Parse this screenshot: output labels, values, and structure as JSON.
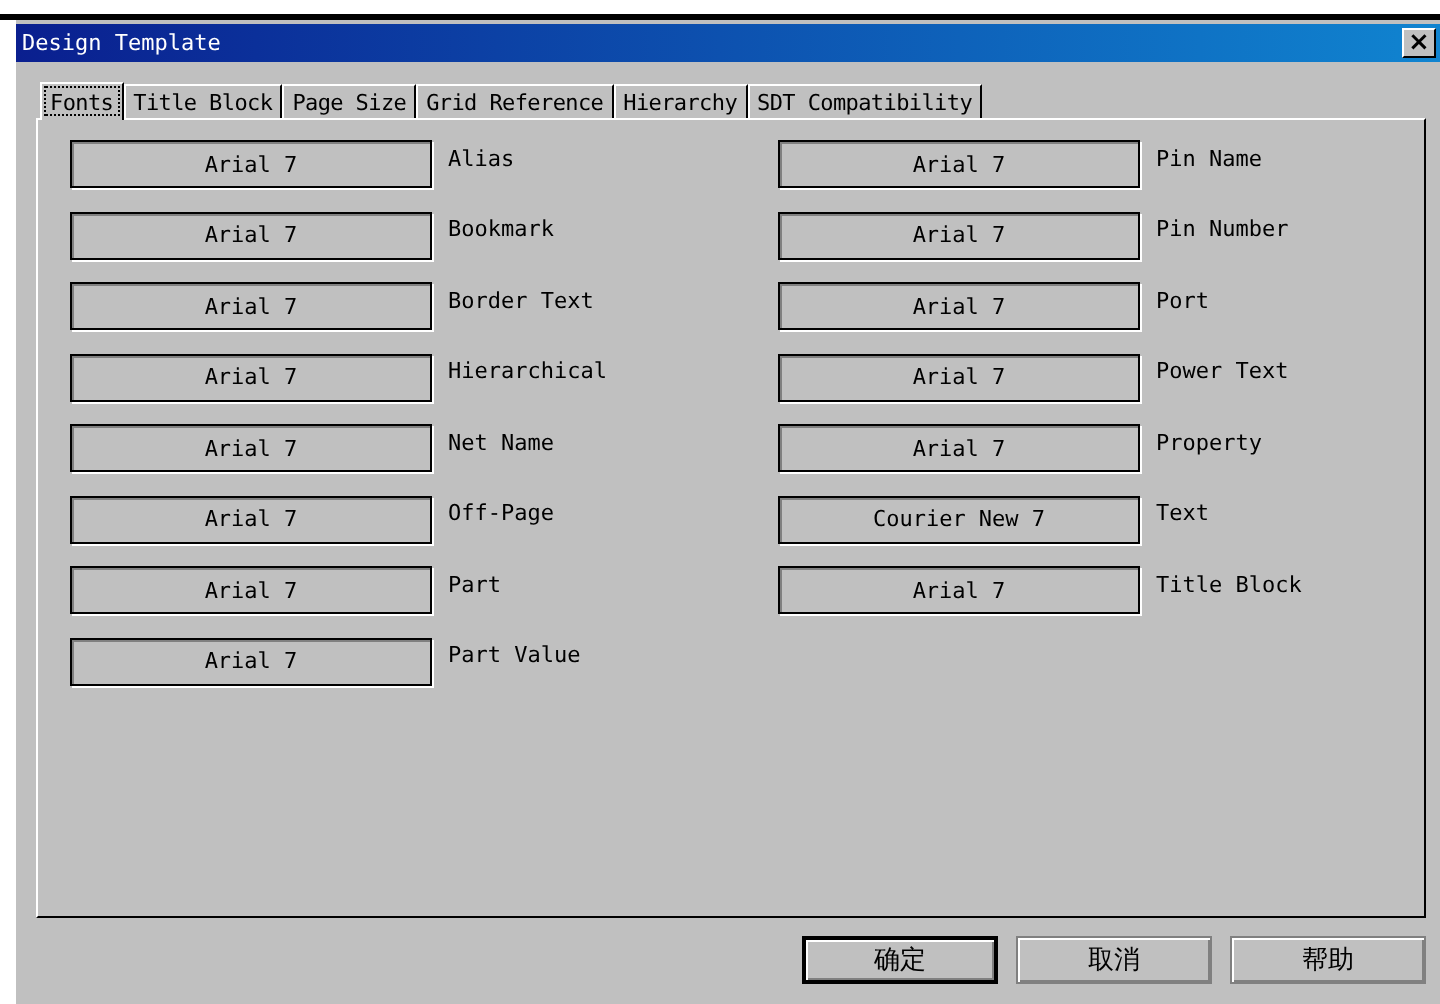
{
  "window": {
    "title": "Design Template",
    "close": "×"
  },
  "tabs": [
    {
      "label": "Fonts",
      "selected": true
    },
    {
      "label": "Title Block",
      "selected": false
    },
    {
      "label": "Page Size",
      "selected": false
    },
    {
      "label": "Grid Reference",
      "selected": false
    },
    {
      "label": "Hierarchy",
      "selected": false
    },
    {
      "label": "SDT Compatibility",
      "selected": false
    }
  ],
  "left_fonts": [
    {
      "font": "Arial 7",
      "label": "Alias"
    },
    {
      "font": "Arial 7",
      "label": "Bookmark"
    },
    {
      "font": "Arial 7",
      "label": "Border Text"
    },
    {
      "font": "Arial 7",
      "label": "Hierarchical"
    },
    {
      "font": "Arial 7",
      "label": "Net Name"
    },
    {
      "font": "Arial 7",
      "label": "Off-Page"
    },
    {
      "font": "Arial 7",
      "label": "Part"
    },
    {
      "font": "Arial 7",
      "label": "Part Value"
    }
  ],
  "right_fonts": [
    {
      "font": "Arial 7",
      "label": "Pin Name"
    },
    {
      "font": "Arial 7",
      "label": "Pin Number"
    },
    {
      "font": "Arial 7",
      "label": "Port"
    },
    {
      "font": "Arial 7",
      "label": "Power Text"
    },
    {
      "font": "Arial 7",
      "label": "Property"
    },
    {
      "font": "Courier New 7",
      "label": "Text"
    },
    {
      "font": "Arial 7",
      "label": "Title Block"
    }
  ],
  "buttons": [
    {
      "label": "确定",
      "default": true
    },
    {
      "label": "取消",
      "default": false
    },
    {
      "label": "帮助",
      "default": false
    }
  ]
}
